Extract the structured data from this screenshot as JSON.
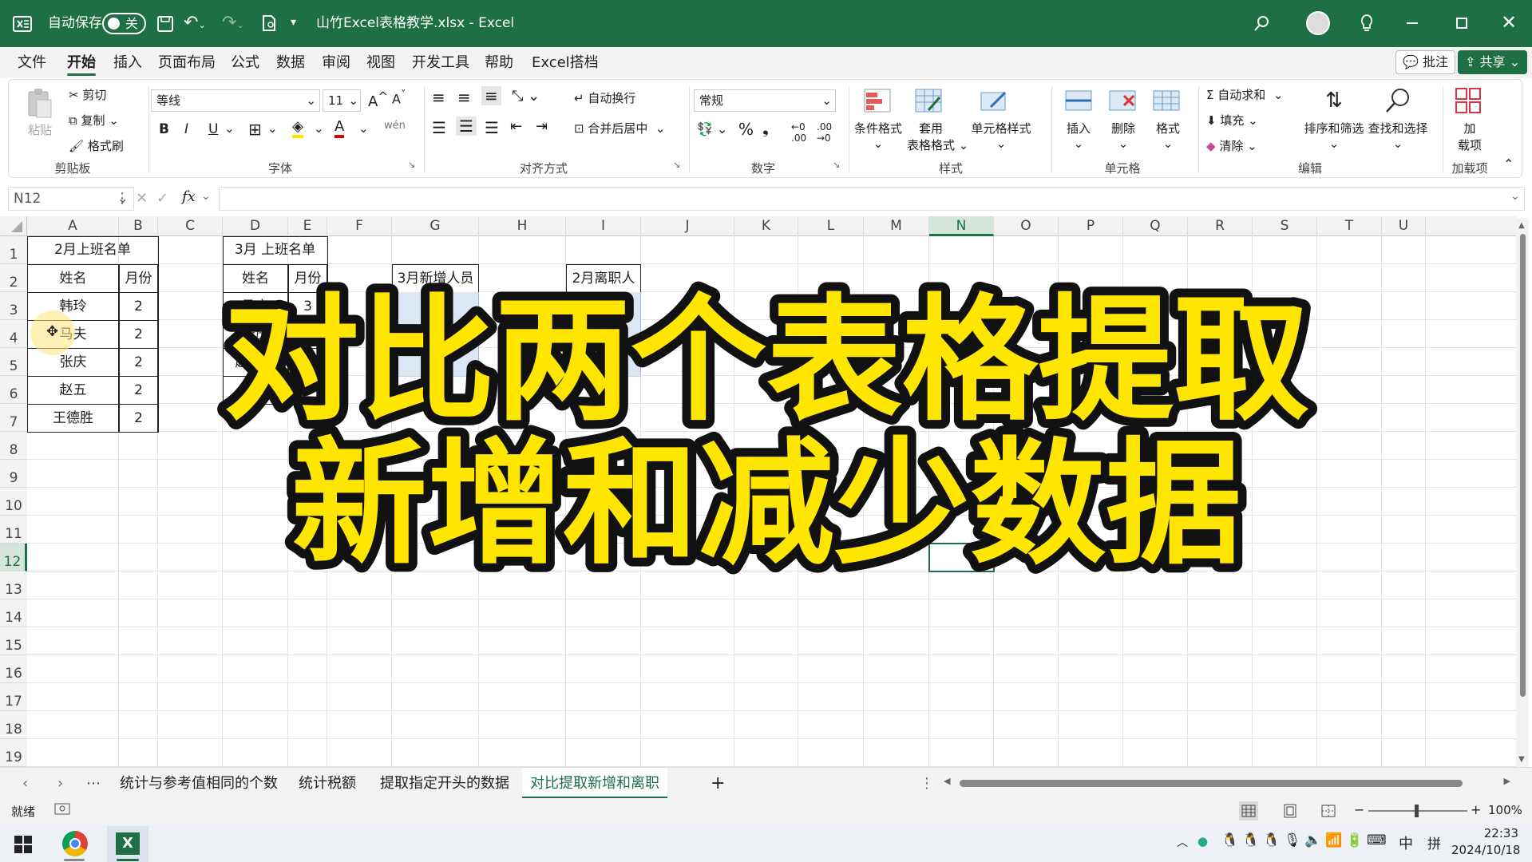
{
  "titlebar": {
    "autosave_label": "自动保存",
    "autosave_state": "关",
    "filename": "山竹Excel表格教学.xlsx",
    "separator": "-",
    "app": "Excel"
  },
  "menu": {
    "items": [
      "文件",
      "开始",
      "插入",
      "页面布局",
      "公式",
      "数据",
      "审阅",
      "视图",
      "开发工具",
      "帮助",
      "Excel搭档"
    ],
    "active": "开始",
    "comment_btn": "批注",
    "share_btn": "共享"
  },
  "ribbon": {
    "clipboard": {
      "paste": "粘贴",
      "cut": "剪切",
      "copy": "复制",
      "format_painter": "格式刷",
      "group": "剪贴板"
    },
    "font": {
      "name": "等线",
      "size": "11",
      "bold": "B",
      "italic": "I",
      "underline": "U",
      "group": "字体"
    },
    "alignment": {
      "wrap": "自动换行",
      "merge": "合并后居中",
      "group": "对齐方式"
    },
    "number": {
      "format": "常规",
      "group": "数字"
    },
    "styles": {
      "conditional": "条件格式",
      "table_l1": "套用",
      "table_l2": "表格格式",
      "cell_styles": "单元格样式",
      "group": "样式"
    },
    "cells": {
      "insert": "插入",
      "delete": "删除",
      "format": "格式",
      "group": "单元格"
    },
    "editing": {
      "autosum": "自动求和",
      "fill": "填充",
      "clear": "清除",
      "sort": "排序和筛选",
      "find": "查找和选择",
      "group": "编辑"
    },
    "addins": {
      "l1": "加",
      "l2": "载项",
      "group": "加载项"
    }
  },
  "formula": {
    "namebox": "N12",
    "fx": "fx",
    "value": ""
  },
  "grid": {
    "columns": [
      "A",
      "B",
      "C",
      "D",
      "E",
      "F",
      "G",
      "H",
      "I",
      "J",
      "K",
      "L",
      "M",
      "N",
      "O",
      "P",
      "Q",
      "R",
      "S",
      "T",
      "U"
    ],
    "rows": [
      "1",
      "2",
      "3",
      "4",
      "5",
      "6",
      "7",
      "8",
      "9",
      "10",
      "11",
      "12",
      "13",
      "14",
      "15",
      "16",
      "17",
      "18",
      "19"
    ],
    "selected_col": "N",
    "selected_row": "12",
    "table_feb": {
      "title": "2月上班名单",
      "headers": [
        "姓名",
        "月份"
      ],
      "rows": [
        [
          "韩玲",
          "2"
        ],
        [
          "马夫",
          "2"
        ],
        [
          "张庆",
          "2"
        ],
        [
          "赵五",
          "2"
        ],
        [
          "王德胜",
          "2"
        ]
      ]
    },
    "table_mar": {
      "title": "3月 上班名单",
      "headers": [
        "姓名",
        "月份"
      ],
      "rows": [
        [
          "马夫",
          "3"
        ],
        [
          "张庆",
          "3"
        ],
        [
          "赵康一",
          "3"
        ],
        [
          "高伟",
          "3"
        ]
      ]
    },
    "new_label": "3月新增人员",
    "left_label": "2月离职人员"
  },
  "overlay": {
    "line1": "对比两个表格提取",
    "line2": "新增和减少数据"
  },
  "sheets": {
    "tabs": [
      "统计与参考值相同的个数",
      "统计税额",
      "提取指定开头的数据",
      "对比提取新增和离职"
    ],
    "active": "对比提取新增和离职",
    "add": "+"
  },
  "status": {
    "ready": "就绪",
    "zoom": "100%"
  },
  "taskbar": {
    "time": "22:33",
    "date": "2024/10/18",
    "ime": "中",
    "ime2": "拼"
  },
  "colors": {
    "excel_green": "#1e6f44",
    "overlay_fill": "#ffe600",
    "overlay_stroke": "#111111"
  }
}
